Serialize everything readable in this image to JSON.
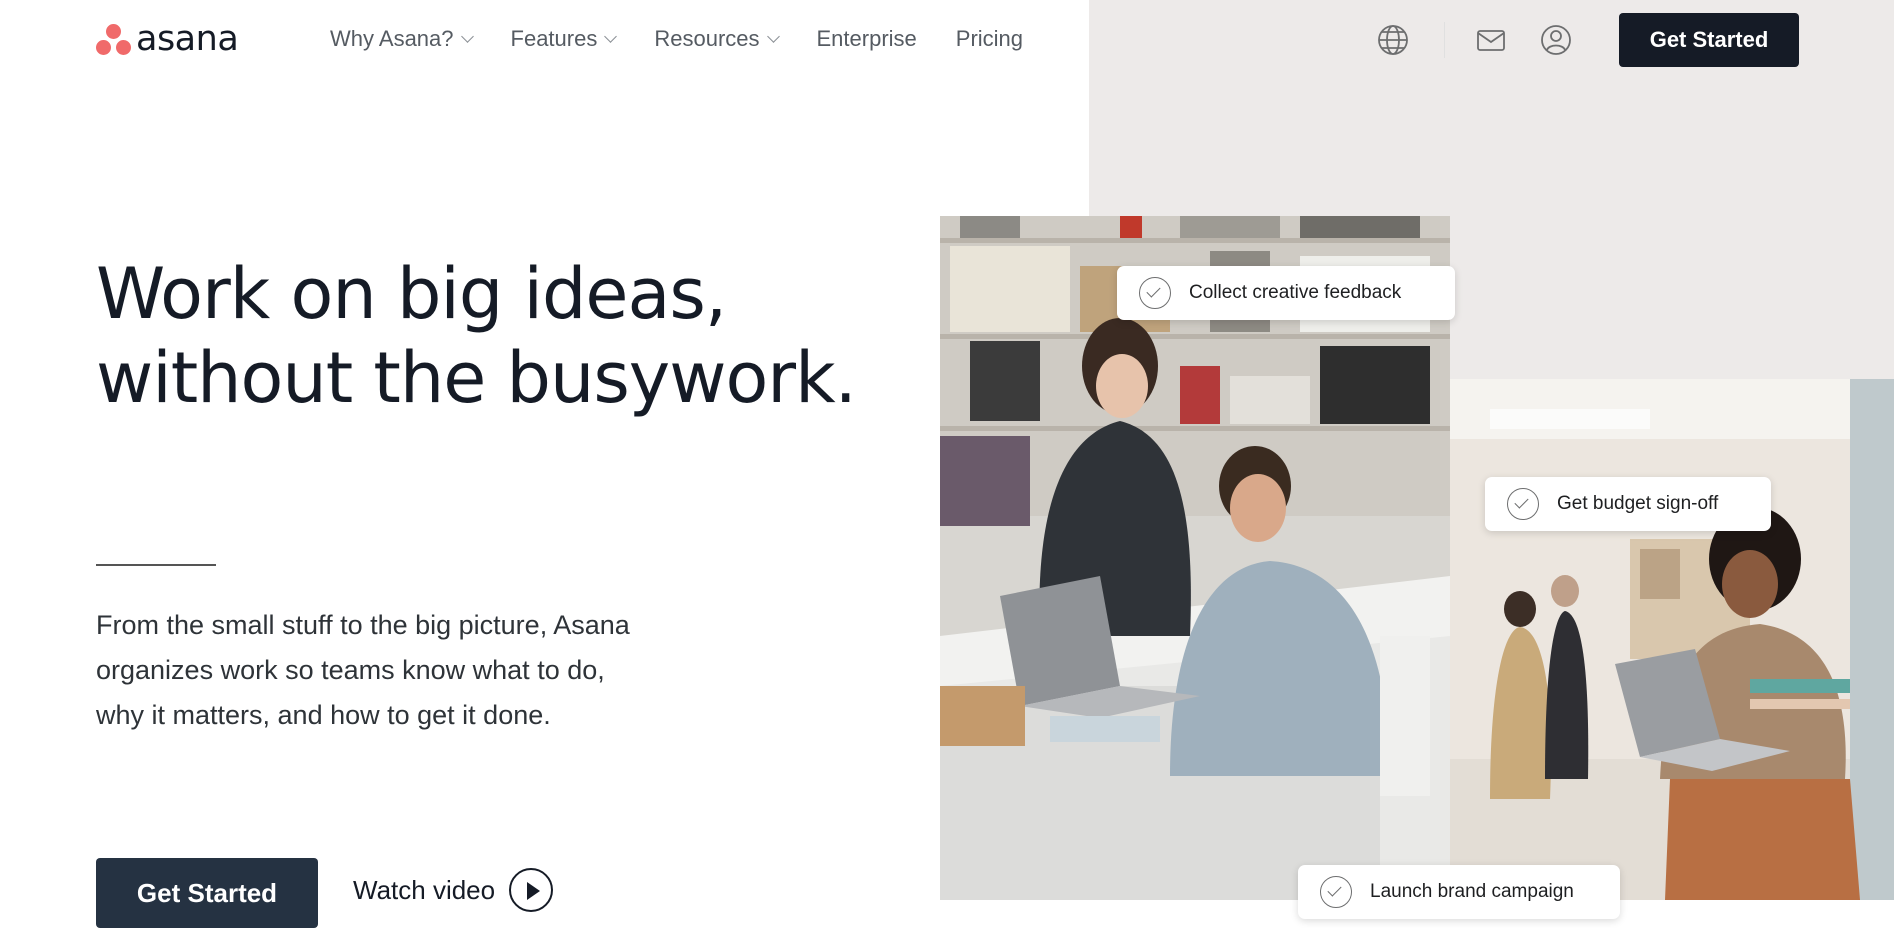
{
  "brand": {
    "name": "asana",
    "accent": "#f06a6a",
    "dark": "#151b26"
  },
  "nav": {
    "items": [
      {
        "label": "Why Asana?",
        "has_dropdown": true
      },
      {
        "label": "Features",
        "has_dropdown": true
      },
      {
        "label": "Resources",
        "has_dropdown": true
      },
      {
        "label": "Enterprise",
        "has_dropdown": false
      },
      {
        "label": "Pricing",
        "has_dropdown": false
      }
    ],
    "icons": [
      "globe-icon",
      "mail-icon",
      "user-icon"
    ],
    "cta_label": "Get Started"
  },
  "hero": {
    "headline_line1": "Work on big ideas,",
    "headline_line2": "without the busywork.",
    "subtext": "From the small stuff to the big picture, Asana organizes work so teams know what to do, why it matters, and how to get it done.",
    "primary_cta": "Get Started",
    "secondary_cta": "Watch video"
  },
  "tasks": [
    {
      "label": "Collect creative feedback"
    },
    {
      "label": "Get budget sign-off"
    },
    {
      "label": "Launch brand campaign"
    }
  ],
  "colors": {
    "panel_bg": "#edeae9",
    "button_dark": "#151b26",
    "cta_dark": "#253242"
  }
}
